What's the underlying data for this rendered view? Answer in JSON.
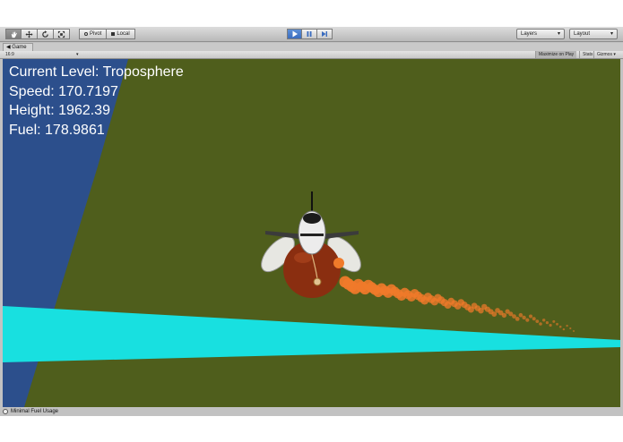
{
  "toolbar": {
    "tools": [
      {
        "name": "hand-tool-button",
        "icon": "hand-icon"
      },
      {
        "name": "move-tool-button",
        "icon": "move-icon"
      },
      {
        "name": "rotate-tool-button",
        "icon": "rotate-icon"
      },
      {
        "name": "scale-tool-button",
        "icon": "scale-icon"
      }
    ],
    "pivot_label": "Pivot",
    "local_label": "Local",
    "layers_label": "Layers",
    "layout_label": "Layout"
  },
  "game_view": {
    "tab_label": "Game",
    "aspect_label": "16:9",
    "maximize_label": "Maximize on Play",
    "stats_label": "Stats",
    "gizmos_label": "Gizmos"
  },
  "hud": {
    "level": "Current Level: Troposphere",
    "speed": "Speed: 170.7197",
    "height": "Height: 1962.39",
    "fuel": "Fuel: 178.9861"
  },
  "status_bar": {
    "message": "Minimal Fuel Usage"
  },
  "colors": {
    "ground": "#4f5e1c",
    "sky_plane": "#2c4f8c",
    "cyan_plane": "#18e0e0",
    "exhaust": "#f07a2a",
    "balloon": "#8a2e10",
    "play_active": "#3a6cbf"
  }
}
